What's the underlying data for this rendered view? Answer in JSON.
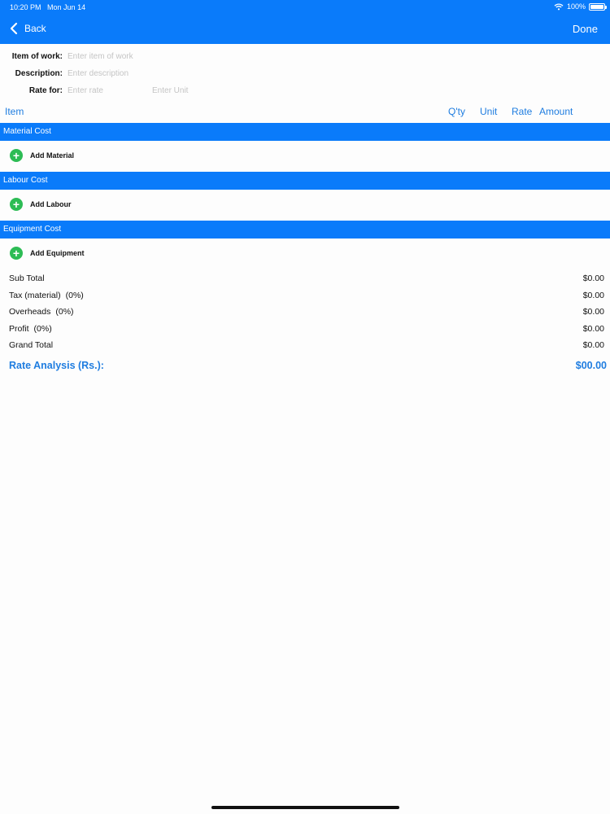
{
  "status_bar": {
    "time": "10:20 PM",
    "date": "Mon Jun 14",
    "battery": "100%"
  },
  "nav": {
    "back_label": "Back",
    "done_label": "Done"
  },
  "form": {
    "item_of_work_label": "Item of work:",
    "item_of_work_placeholder": "Enter item of work",
    "description_label": "Description:",
    "description_placeholder": "Enter description",
    "rate_for_label": "Rate for:",
    "rate_placeholder": "Enter rate",
    "unit_placeholder": "Enter Unit"
  },
  "columns": {
    "item": "Item",
    "qty": "Q'ty",
    "unit": "Unit",
    "rate": "Rate",
    "amount": "Amount"
  },
  "sections": {
    "material": {
      "title": "Material Cost",
      "add_label": "Add Material"
    },
    "labour": {
      "title": "Labour Cost",
      "add_label": "Add Labour"
    },
    "equipment": {
      "title": "Equipment Cost",
      "add_label": "Add Equipment"
    }
  },
  "summary": {
    "sub_total": {
      "label": "Sub Total",
      "value": "$0.00"
    },
    "tax": {
      "label": "Tax (material)",
      "pct": "(0%)",
      "value": "$0.00"
    },
    "overheads": {
      "label": "Overheads",
      "pct": "(0%)",
      "value": "$0.00"
    },
    "profit": {
      "label": "Profit",
      "pct": "(0%)",
      "value": "$0.00"
    },
    "grand_total": {
      "label": "Grand Total",
      "value": "$0.00"
    }
  },
  "rate_analysis": {
    "label": "Rate Analysis (Rs.):",
    "value": "$00.00"
  },
  "colors": {
    "accent": "#0a7bfa",
    "link_text": "#1f7de0",
    "add_green": "#2dbc55"
  }
}
